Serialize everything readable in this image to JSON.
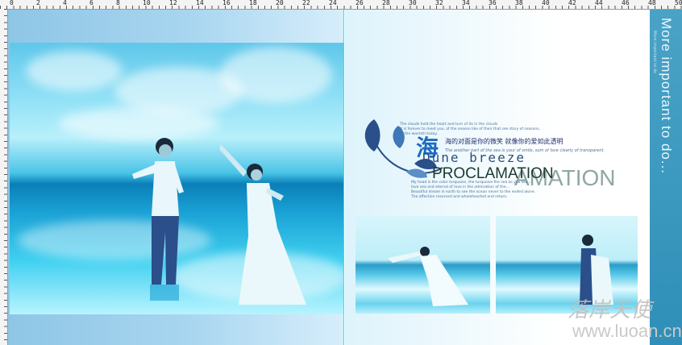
{
  "ruler": {
    "labels": [
      "0",
      "2",
      "4",
      "6",
      "8",
      "10",
      "12",
      "14",
      "16",
      "18",
      "20",
      "22",
      "24",
      "26",
      "28",
      "30",
      "32",
      "34",
      "36",
      "38",
      "40",
      "42",
      "44",
      "46",
      "48",
      "50"
    ]
  },
  "right_page": {
    "sidebar_title": "More important to do...",
    "sidebar_subtitle": "More important to do",
    "en_top": [
      "The clouds hold the heart and turn of its in the clouds",
      "It is forever to meet you, of the season like of their that see story of seasons,",
      "of the warmth today."
    ],
    "big_char": "海",
    "cn_line": "海的对面是你的微笑 就像你的爱如此透明",
    "en_mid": "The another part of the sea is your of smile, sum of love clearly of transparent.",
    "dune": "Dune breeze",
    "proclamation": "PROCLAMATION",
    "proclamation_ghost": "AMATION",
    "en_bottom": [
      "My head is the color turquoise, the turquoise the sea as you like...",
      "love sea and eternal of love in the admiration of the...",
      "Beautiful dream in earth to see the ocean never to the ended alone.",
      "The affection reserved and wholehearted and return."
    ]
  },
  "watermark": {
    "cn": "落岸天使",
    "url": "www.luoan.cn"
  },
  "colors": {
    "sidebar": "#3b9ac0",
    "guide": "#3fd8f0",
    "brand_text": "#1e6bbf"
  }
}
